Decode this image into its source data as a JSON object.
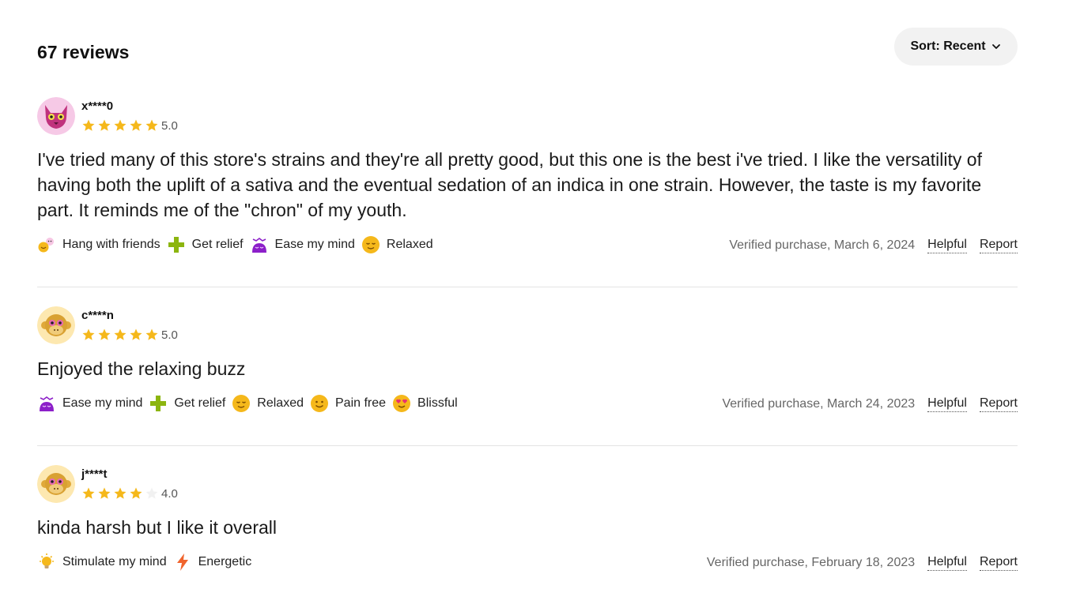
{
  "header": {
    "title": "67 reviews",
    "sort_label": "Sort: Recent"
  },
  "reviews": [
    {
      "user": "x****0",
      "avatar": "pink-cat-avatar",
      "rating": 5,
      "rating_label": "5.0",
      "text": "I've tried many of this store's strains and they're all pretty good, but this one is the best i've tried. I like the versatility of having both the uplift of a sativa and the eventual sedation of an indica in one strain. However, the taste is my favorite part. It reminds me of the \"chron\" of my youth.",
      "tags": [
        {
          "label": "Hang with friends",
          "icon": "friends-icon"
        },
        {
          "label": "Get relief",
          "icon": "plus-icon"
        },
        {
          "label": "Ease my mind",
          "icon": "ease-mind-icon"
        },
        {
          "label": "Relaxed",
          "icon": "relaxed-face-icon"
        }
      ],
      "verified": "Verified purchase, March 6, 2024",
      "helpful": "Helpful",
      "report": "Report"
    },
    {
      "user": "c****n",
      "avatar": "monkey-avatar",
      "rating": 5,
      "rating_label": "5.0",
      "text": "Enjoyed the relaxing buzz",
      "tags": [
        {
          "label": "Ease my mind",
          "icon": "ease-mind-icon"
        },
        {
          "label": "Get relief",
          "icon": "plus-icon"
        },
        {
          "label": "Relaxed",
          "icon": "relaxed-face-icon"
        },
        {
          "label": "Pain free",
          "icon": "smile-face-icon"
        },
        {
          "label": "Blissful",
          "icon": "heart-eyes-icon"
        }
      ],
      "verified": "Verified purchase, March 24, 2023",
      "helpful": "Helpful",
      "report": "Report"
    },
    {
      "user": "j****t",
      "avatar": "monkey-avatar",
      "rating": 4,
      "rating_label": "4.0",
      "text": "kinda harsh but I like it overall",
      "tags": [
        {
          "label": "Stimulate my mind",
          "icon": "lightbulb-icon"
        },
        {
          "label": "Energetic",
          "icon": "lightning-icon"
        }
      ],
      "verified": "Verified purchase, February 18, 2023",
      "helpful": "Helpful",
      "report": "Report"
    }
  ]
}
